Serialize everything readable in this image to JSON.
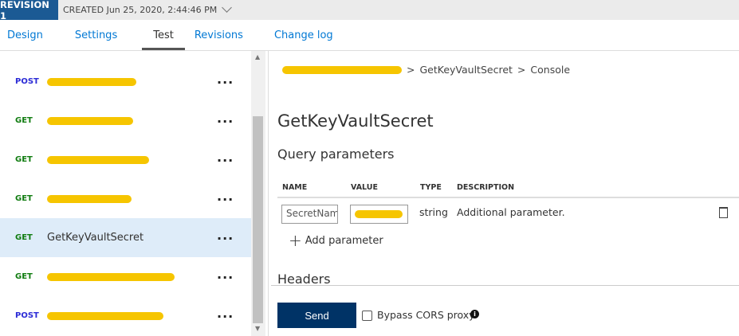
{
  "header": {
    "revision": "REVISION 1",
    "created": "CREATED Jun 25, 2020, 2:44:46 PM"
  },
  "tabs": [
    {
      "label": "Design"
    },
    {
      "label": "Settings"
    },
    {
      "label": "Test"
    },
    {
      "label": "Revisions"
    },
    {
      "label": "Change log"
    }
  ],
  "operations": [
    {
      "method": "POST"
    },
    {
      "method": "GET"
    },
    {
      "method": "GET"
    },
    {
      "method": "GET"
    },
    {
      "method": "GET",
      "name": "GetKeyVaultSecret"
    },
    {
      "method": "GET"
    },
    {
      "method": "POST"
    }
  ],
  "more_label": "...",
  "breadcrumb": {
    "op": "GetKeyVaultSecret",
    "page": "Console",
    "sep": ">"
  },
  "title": "GetKeyVaultSecret",
  "query": {
    "heading": "Query parameters",
    "columns": [
      "NAME",
      "VALUE",
      "TYPE",
      "DESCRIPTION"
    ],
    "row": {
      "name": "SecretName",
      "type": "string",
      "description": "Additional parameter."
    },
    "add_label": "Add parameter"
  },
  "headers_heading": "Headers",
  "send_label": "Send",
  "bypass_label": "Bypass CORS proxy",
  "colors": {
    "accent": "#0078d4",
    "revision": "#1b5a94",
    "send": "#003366",
    "selected": "#deecf9"
  }
}
